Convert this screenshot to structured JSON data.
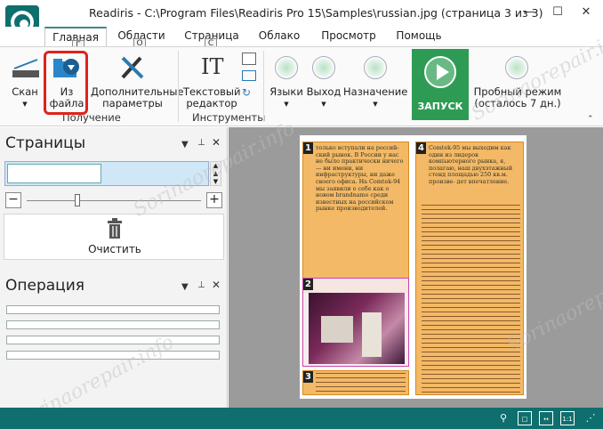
{
  "window": {
    "title": "Readiris - C:\\Program Files\\Readiris Pro 15\\Samples\\russian.jpg (страница 3 из 3)",
    "minimize": "—",
    "maximize": "☐",
    "close": "✕"
  },
  "tabs": [
    {
      "label": "Главная",
      "key": "Г"
    },
    {
      "label": "Области",
      "key": "О"
    },
    {
      "label": "Страница",
      "key": "С"
    },
    {
      "label": "Облако",
      "key": ""
    },
    {
      "label": "Просмотр",
      "key": ""
    },
    {
      "label": "Помощь",
      "key": ""
    }
  ],
  "ribbon": {
    "scan": "Скан",
    "from_file_1": "Из",
    "from_file_2": "файла",
    "additional_1": "Дополнительные",
    "additional_2": "параметры",
    "group_acquire": "Получение",
    "text_editor_1": "Текстовый",
    "text_editor_2": "редактор",
    "group_tools": "Инструменты",
    "languages": "Языки",
    "output": "Выход",
    "destination": "Назначение",
    "run": "ЗАПУСК",
    "trial_1": "Пробный режим",
    "trial_2": "(осталось 7 дн.)"
  },
  "pages_panel": {
    "title": "Страницы",
    "clear": "Очистить"
  },
  "operation_panel": {
    "title": "Операция"
  },
  "document": {
    "zone_numbers": [
      "1",
      "2",
      "3",
      "4"
    ],
    "zone1_text": "только вступали на россий- ский рынок. В России у нас не было практически ничего — ни имени, ни инфраструктуры, ни даже своего офиса. На Comtek-94 мы заявили о себе как о новом brandname среди известных на российском рынке производителей.",
    "zone4_text": "Comtek-95 мы выходим как один из лидеров компьютерного рынка, я, полагаю, наш двухэтажный стенд площадью 250 кв.м. произве- дет впечатление."
  },
  "watermark": "Sorinaorepair.info",
  "colors": {
    "accent": "#0f6f6e",
    "run": "#2e9b55",
    "highlight": "#e0221c",
    "zone": "#f0a53c"
  }
}
